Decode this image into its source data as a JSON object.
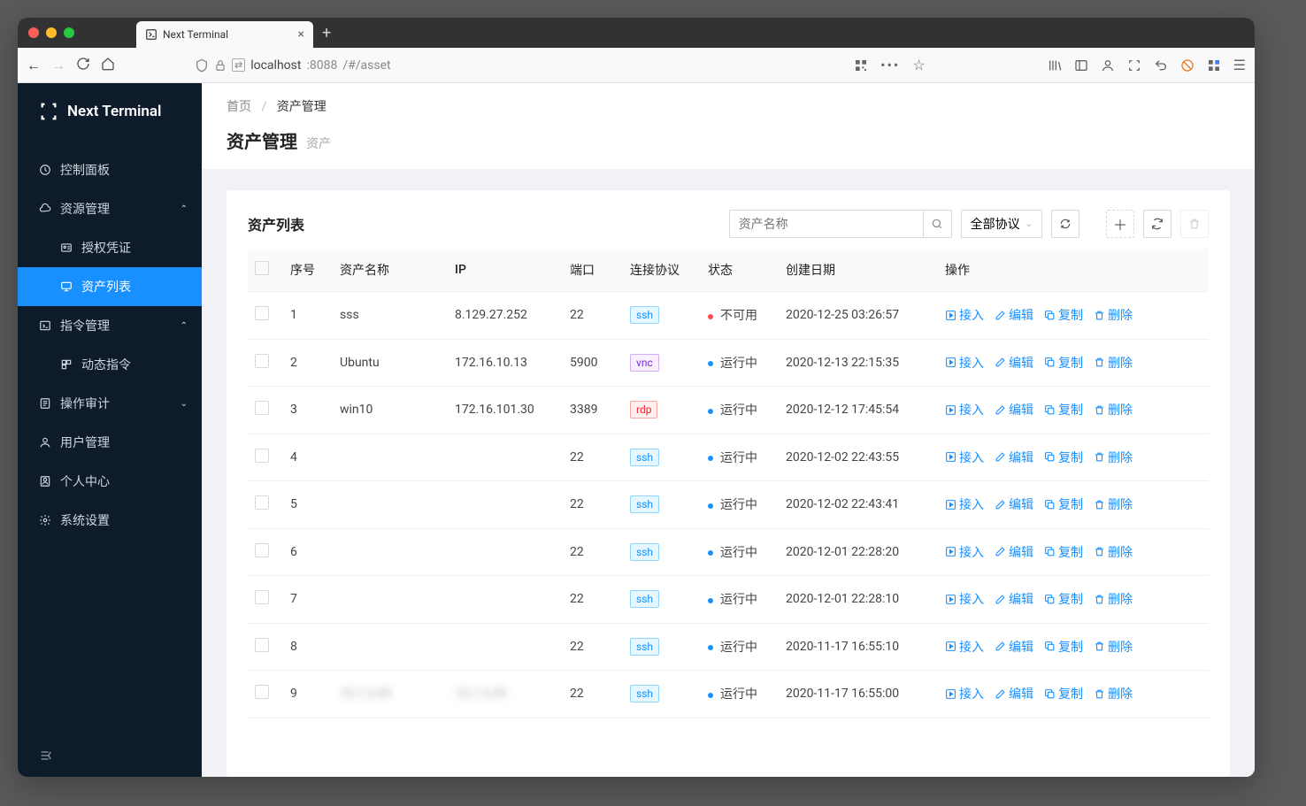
{
  "browser": {
    "tab_title": "Next Terminal",
    "url_pre": "localhost",
    "url_port": ":8088",
    "url_path": "/#/asset"
  },
  "app": {
    "name": "Next Terminal"
  },
  "sidebar": {
    "dashboard": "控制面板",
    "resource": "资源管理",
    "credential": "授权凭证",
    "asset": "资产列表",
    "command": "指令管理",
    "dynamic_cmd": "动态指令",
    "audit": "操作审计",
    "user": "用户管理",
    "profile": "个人中心",
    "settings": "系统设置"
  },
  "breadcrumb": {
    "home": "首页",
    "current": "资产管理"
  },
  "page": {
    "title": "资产管理",
    "subtitle": "资产"
  },
  "list": {
    "title": "资产列表",
    "search_placeholder": "资产名称",
    "proto_all": "全部协议"
  },
  "columns": {
    "idx": "序号",
    "name": "资产名称",
    "ip": "IP",
    "port": "端口",
    "proto": "连接协议",
    "status": "状态",
    "date": "创建日期",
    "actions": "操作"
  },
  "status_labels": {
    "down": "不可用",
    "up": "运行中"
  },
  "proto_labels": {
    "ssh": "ssh",
    "vnc": "vnc",
    "rdp": "rdp"
  },
  "action_labels": {
    "connect": "接入",
    "edit": "编辑",
    "copy": "复制",
    "delete": "删除"
  },
  "rows": [
    {
      "idx": "1",
      "name": "sss",
      "ip": "8.129.27.252",
      "port": "22",
      "proto": "ssh",
      "status_key": "down",
      "dot": "red",
      "date": "2020-12-25 03:26:57"
    },
    {
      "idx": "2",
      "name": "Ubuntu",
      "ip": "172.16.10.13",
      "port": "5900",
      "proto": "vnc",
      "status_key": "up",
      "dot": "blue",
      "date": "2020-12-13 22:15:35"
    },
    {
      "idx": "3",
      "name": "win10",
      "ip": "172.16.101.30",
      "port": "3389",
      "proto": "rdp",
      "status_key": "up",
      "dot": "blue",
      "date": "2020-12-12 17:45:54"
    },
    {
      "idx": "4",
      "name": "",
      "ip": "",
      "port": "22",
      "proto": "ssh",
      "status_key": "up",
      "dot": "blue",
      "date": "2020-12-02 22:43:55",
      "blurred": true
    },
    {
      "idx": "5",
      "name": "",
      "ip": "",
      "port": "22",
      "proto": "ssh",
      "status_key": "up",
      "dot": "blue",
      "date": "2020-12-02 22:43:41",
      "blurred": true
    },
    {
      "idx": "6",
      "name": "",
      "ip": "",
      "port": "22",
      "proto": "ssh",
      "status_key": "up",
      "dot": "blue",
      "date": "2020-12-01 22:28:20",
      "blurred": true
    },
    {
      "idx": "7",
      "name": "",
      "ip": "",
      "port": "22",
      "proto": "ssh",
      "status_key": "up",
      "dot": "blue",
      "date": "2020-12-01 22:28:10",
      "blurred": true
    },
    {
      "idx": "8",
      "name": "",
      "ip": "",
      "port": "22",
      "proto": "ssh",
      "status_key": "up",
      "dot": "blue",
      "date": "2020-11-17 16:55:10",
      "blurred": true
    },
    {
      "idx": "9",
      "name": "10.1.5.49",
      "ip": "10.1.5.49",
      "port": "22",
      "proto": "ssh",
      "status_key": "up",
      "dot": "blue",
      "date": "2020-11-17 16:55:00",
      "blurred": true
    }
  ]
}
